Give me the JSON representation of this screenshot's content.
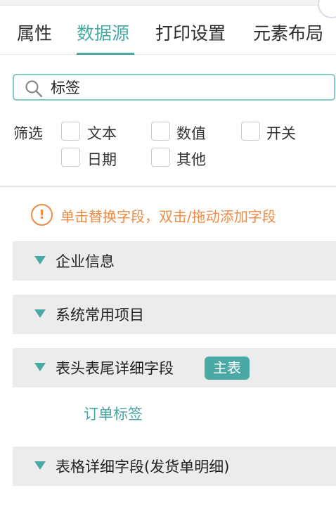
{
  "tabs": [
    {
      "label": "属性"
    },
    {
      "label": "数据源"
    },
    {
      "label": "打印设置"
    },
    {
      "label": "元素布局"
    }
  ],
  "search": {
    "value": "标签"
  },
  "filter": {
    "label": "筛选",
    "options": [
      "文本",
      "数值",
      "开关",
      "日期",
      "其他"
    ]
  },
  "hint": {
    "icon_text": "!",
    "text": "单击替换字段，双击/拖动添加字段"
  },
  "groups": [
    {
      "label": "企业信息"
    },
    {
      "label": "系统常用项目"
    },
    {
      "label": "表头表尾详细字段",
      "badge": "主表"
    },
    {
      "label": "表格详细字段(发货单明细)"
    }
  ],
  "field_item": "订单标签",
  "colors": {
    "accent": "#4aa9a4",
    "warning": "#ef8b45"
  }
}
